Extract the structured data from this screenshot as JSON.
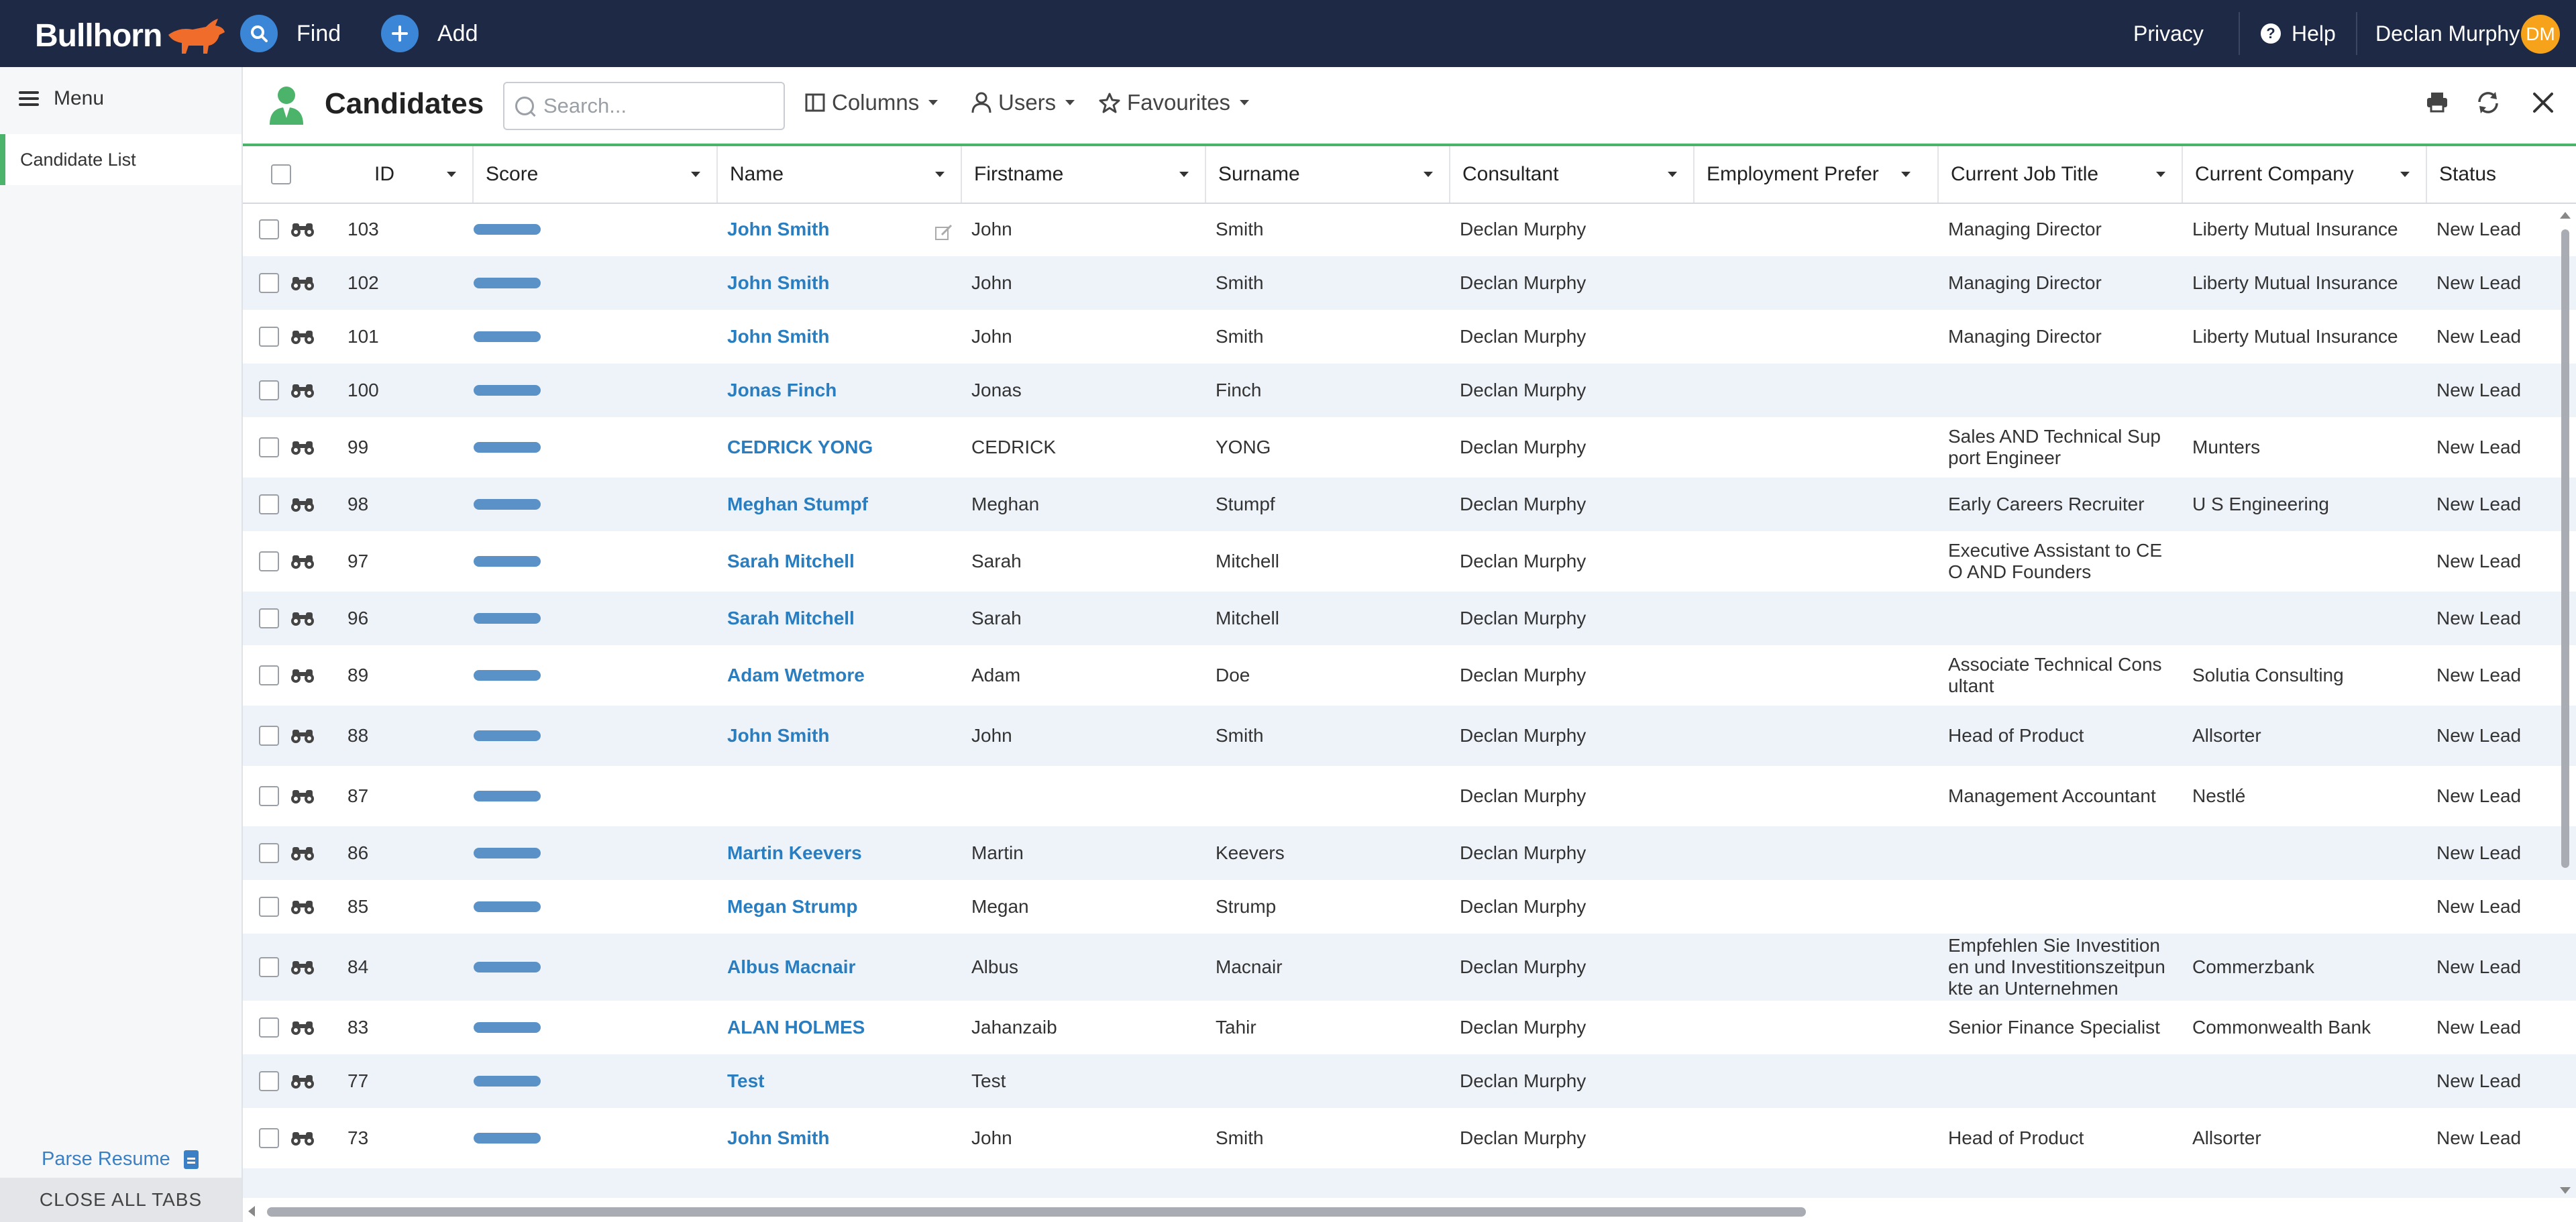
{
  "topbar": {
    "brand": "Bullhorn",
    "find": "Find",
    "add": "Add",
    "privacy": "Privacy",
    "help": "Help",
    "user_name": "Declan Murphy",
    "user_initials": "DM"
  },
  "sidebar": {
    "menu": "Menu",
    "items": [
      {
        "label": "Candidate List"
      }
    ],
    "parse_resume": "Parse Resume",
    "close_all_tabs": "CLOSE ALL TABS"
  },
  "main": {
    "title": "Candidates",
    "search_placeholder": "Search...",
    "columns": "Columns",
    "users": "Users",
    "favourites": "Favourites"
  },
  "table": {
    "headers": [
      "ID",
      "Score",
      "Name",
      "Firstname",
      "Surname",
      "Consultant",
      "Employment Prefer",
      "Current Job Title",
      "Current Company",
      "Status"
    ],
    "rows": [
      {
        "id": "103",
        "name": "John Smith",
        "first": "John",
        "sur": "Smith",
        "cons": "Declan Murphy",
        "job": "Managing Director",
        "company": "Liberty Mutual Insurance",
        "status": "New Lead"
      },
      {
        "id": "102",
        "name": "John Smith",
        "first": "John",
        "sur": "Smith",
        "cons": "Declan Murphy",
        "job": "Managing Director",
        "company": "Liberty Mutual Insurance",
        "status": "New Lead"
      },
      {
        "id": "101",
        "name": "John Smith",
        "first": "John",
        "sur": "Smith",
        "cons": "Declan Murphy",
        "job": "Managing Director",
        "company": "Liberty Mutual Insurance",
        "status": "New Lead"
      },
      {
        "id": "100",
        "name": "Jonas Finch",
        "first": "Jonas",
        "sur": "Finch",
        "cons": "Declan Murphy",
        "job": "",
        "company": "",
        "status": "New Lead"
      },
      {
        "id": "99",
        "name": "CEDRICK YONG",
        "first": "CEDRICK",
        "sur": "YONG",
        "cons": "Declan Murphy",
        "job": "Sales AND Technical Support Engineer",
        "company": "Munters",
        "status": "New Lead"
      },
      {
        "id": "98",
        "name": "Meghan Stumpf",
        "first": "Meghan",
        "sur": "Stumpf",
        "cons": "Declan Murphy",
        "job": "Early Careers Recruiter",
        "company": "U S Engineering",
        "status": "New Lead"
      },
      {
        "id": "97",
        "name": "Sarah Mitchell",
        "first": "Sarah",
        "sur": "Mitchell",
        "cons": "Declan Murphy",
        "job": "Executive Assistant to CEO AND Founders",
        "company": "",
        "status": "New Lead"
      },
      {
        "id": "96",
        "name": "Sarah Mitchell",
        "first": "Sarah",
        "sur": "Mitchell",
        "cons": "Declan Murphy",
        "job": "",
        "company": "",
        "status": "New Lead"
      },
      {
        "id": "89",
        "name": "Adam Wetmore",
        "first": "Adam",
        "sur": "Doe",
        "cons": "Declan Murphy",
        "job": "Associate Technical Consultant",
        "company": "Solutia Consulting",
        "status": "New Lead"
      },
      {
        "id": "88",
        "name": "John Smith",
        "first": "John",
        "sur": "Smith",
        "cons": "Declan Murphy",
        "job": "Head of Product",
        "company": "Allsorter",
        "status": "New Lead"
      },
      {
        "id": "87",
        "name": "",
        "first": "",
        "sur": "",
        "cons": "Declan Murphy",
        "job": "Management Accountant",
        "company": "Nestlé",
        "status": "New Lead"
      },
      {
        "id": "86",
        "name": "Martin Keevers",
        "first": "Martin",
        "sur": "Keevers",
        "cons": "Declan Murphy",
        "job": "",
        "company": "",
        "status": "New Lead"
      },
      {
        "id": "85",
        "name": "Megan Strump",
        "first": "Megan",
        "sur": "Strump",
        "cons": "Declan Murphy",
        "job": "",
        "company": "",
        "status": "New Lead"
      },
      {
        "id": "84",
        "name": "Albus Macnair",
        "first": "Albus",
        "sur": "Macnair",
        "cons": "Declan Murphy",
        "job": "Empfehlen Sie Investitionen und Investitionszeitpunkte an Unternehmen",
        "company": "Commerzbank",
        "status": "New Lead"
      },
      {
        "id": "83",
        "name": "ALAN HOLMES",
        "first": "Jahanzaib",
        "sur": "Tahir",
        "cons": "Declan Murphy",
        "job": "Senior Finance Specialist",
        "company": "Commonwealth Bank",
        "status": "New Lead"
      },
      {
        "id": "77",
        "name": "Test",
        "first": "Test",
        "sur": "",
        "cons": "Declan Murphy",
        "job": "",
        "company": "",
        "status": "New Lead"
      },
      {
        "id": "73",
        "name": "John Smith",
        "first": "John",
        "sur": "Smith",
        "cons": "Declan Murphy",
        "job": "Head of Product",
        "company": "Allsorter",
        "status": "New Lead"
      }
    ]
  },
  "colors": {
    "navbar": "#1e2a45",
    "accent": "#4cb36a",
    "link": "#2a7dbf",
    "avatar": "#f6a21b",
    "score": "#5a92c7"
  }
}
